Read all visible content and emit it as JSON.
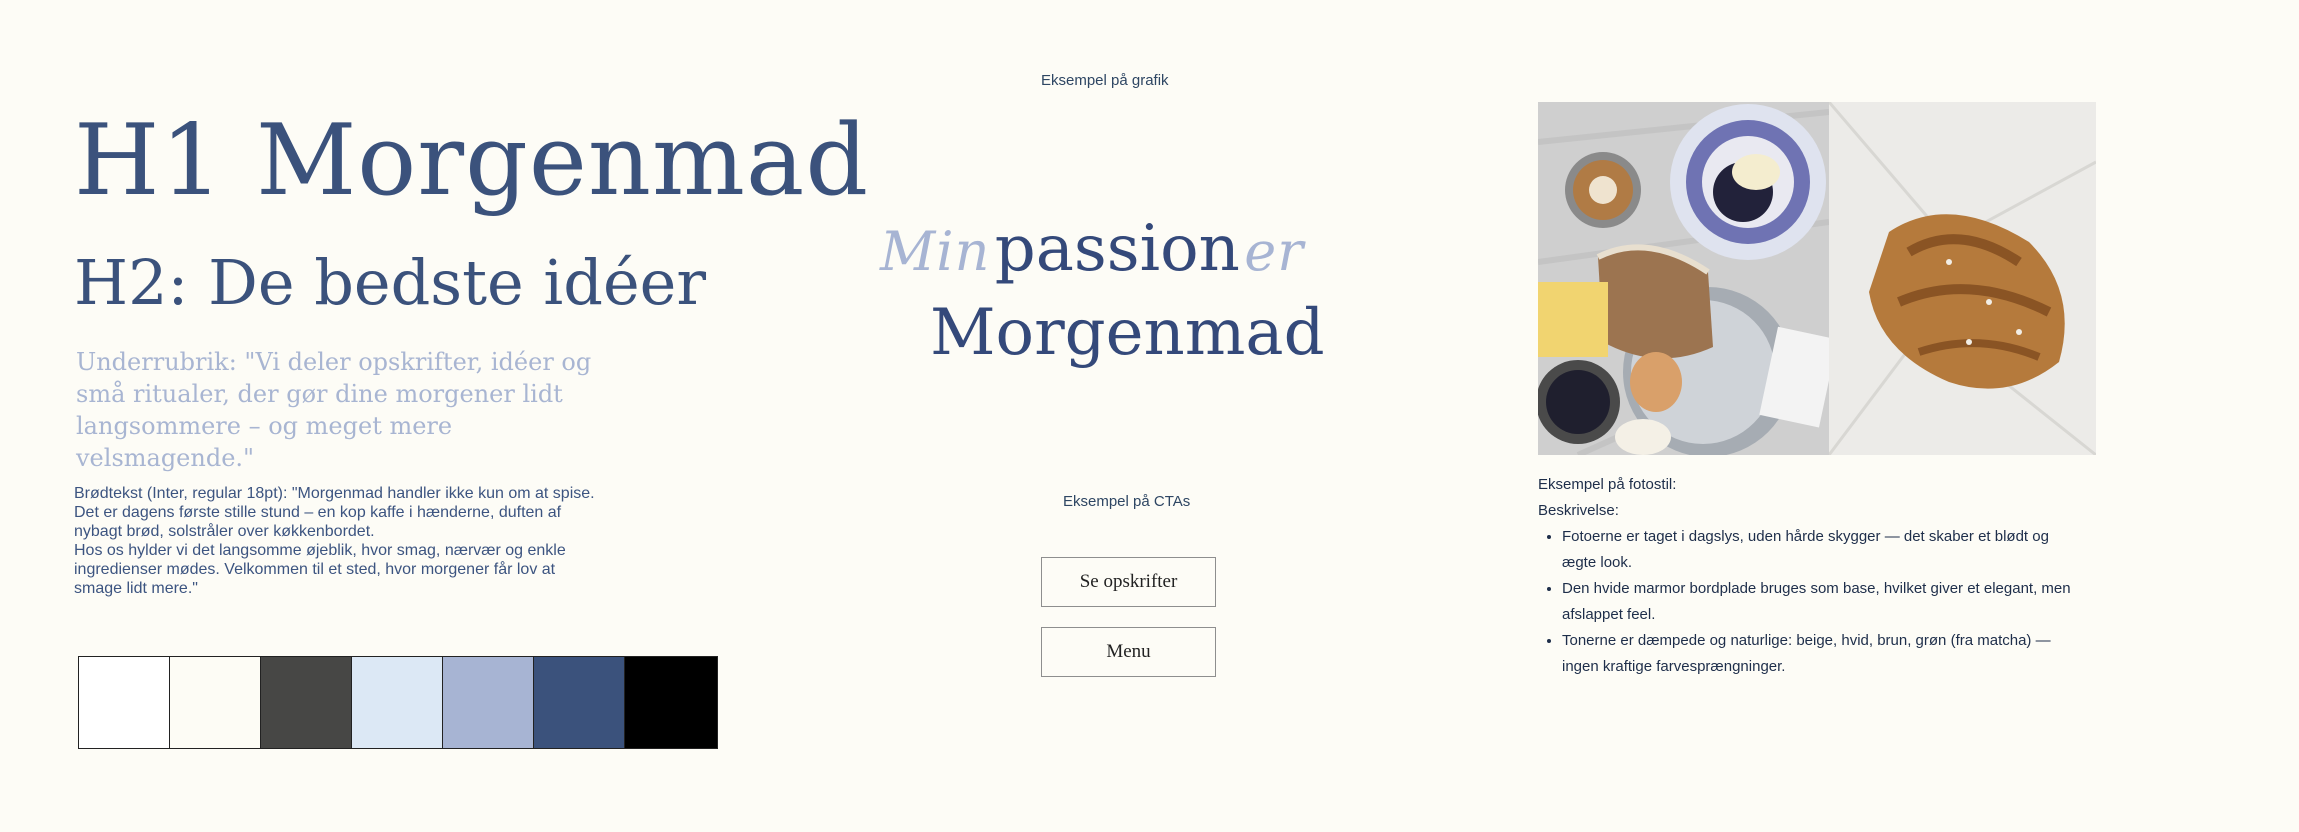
{
  "typography": {
    "h1": "H1 Morgenmad",
    "h2": "H2: De bedste idéer",
    "subheading": "Underrubrik: \"Vi deler opskrifter, idéer og små ritualer, der gør dine morgener lidt langsommere – og meget mere velsmagende.\"",
    "body": "Brødtekst (Inter, regular 18pt): \"Morgenmad handler ikke kun om at spise.\nDet er dagens første stille stund – en kop kaffe i hænderne, duften af\nnybagt brød, solstråler over køkkenbordet.\n Hos os hylder vi det langsomme øjeblik, hvor smag, nærvær og enkle\ningredienser mødes. Velkommen til et sted, hvor morgener får lov at\nsmage lidt mere.\""
  },
  "palette": {
    "swatches": [
      "#ffffff",
      "#fdfcf5",
      "#474745",
      "#dce8f5",
      "#a7b4d3",
      "#3b527c",
      "#000000"
    ]
  },
  "graphic": {
    "label": "Eksempel på grafik",
    "logo": {
      "script_left": "Min",
      "main_1": "passion",
      "script_right": "er",
      "main_2": "Morgenmad"
    }
  },
  "ctas": {
    "label": "Eksempel på CTAs",
    "primary": "Se opskrifter",
    "secondary": "Menu"
  },
  "photo_style": {
    "heading": "Eksempel på fotostil:",
    "description_label": "Beskrivelse:",
    "bullets": [
      "Fotoerne er taget i dagslys, uden hårde skygger — det skaber et blødt og ægte look.",
      "Den hvide marmor bordplade bruges som base, hvilket giver et elegant, men afslappet feel.",
      "Tonerne er dæmpede og naturlige: beige, hvid, brun, grøn (fra matcha) — ingen kraftige farvesprængninger."
    ]
  },
  "colors": {
    "background": "#fdfcf6",
    "primary_blue": "#3b527c",
    "light_blue": "#a7b4d3"
  }
}
